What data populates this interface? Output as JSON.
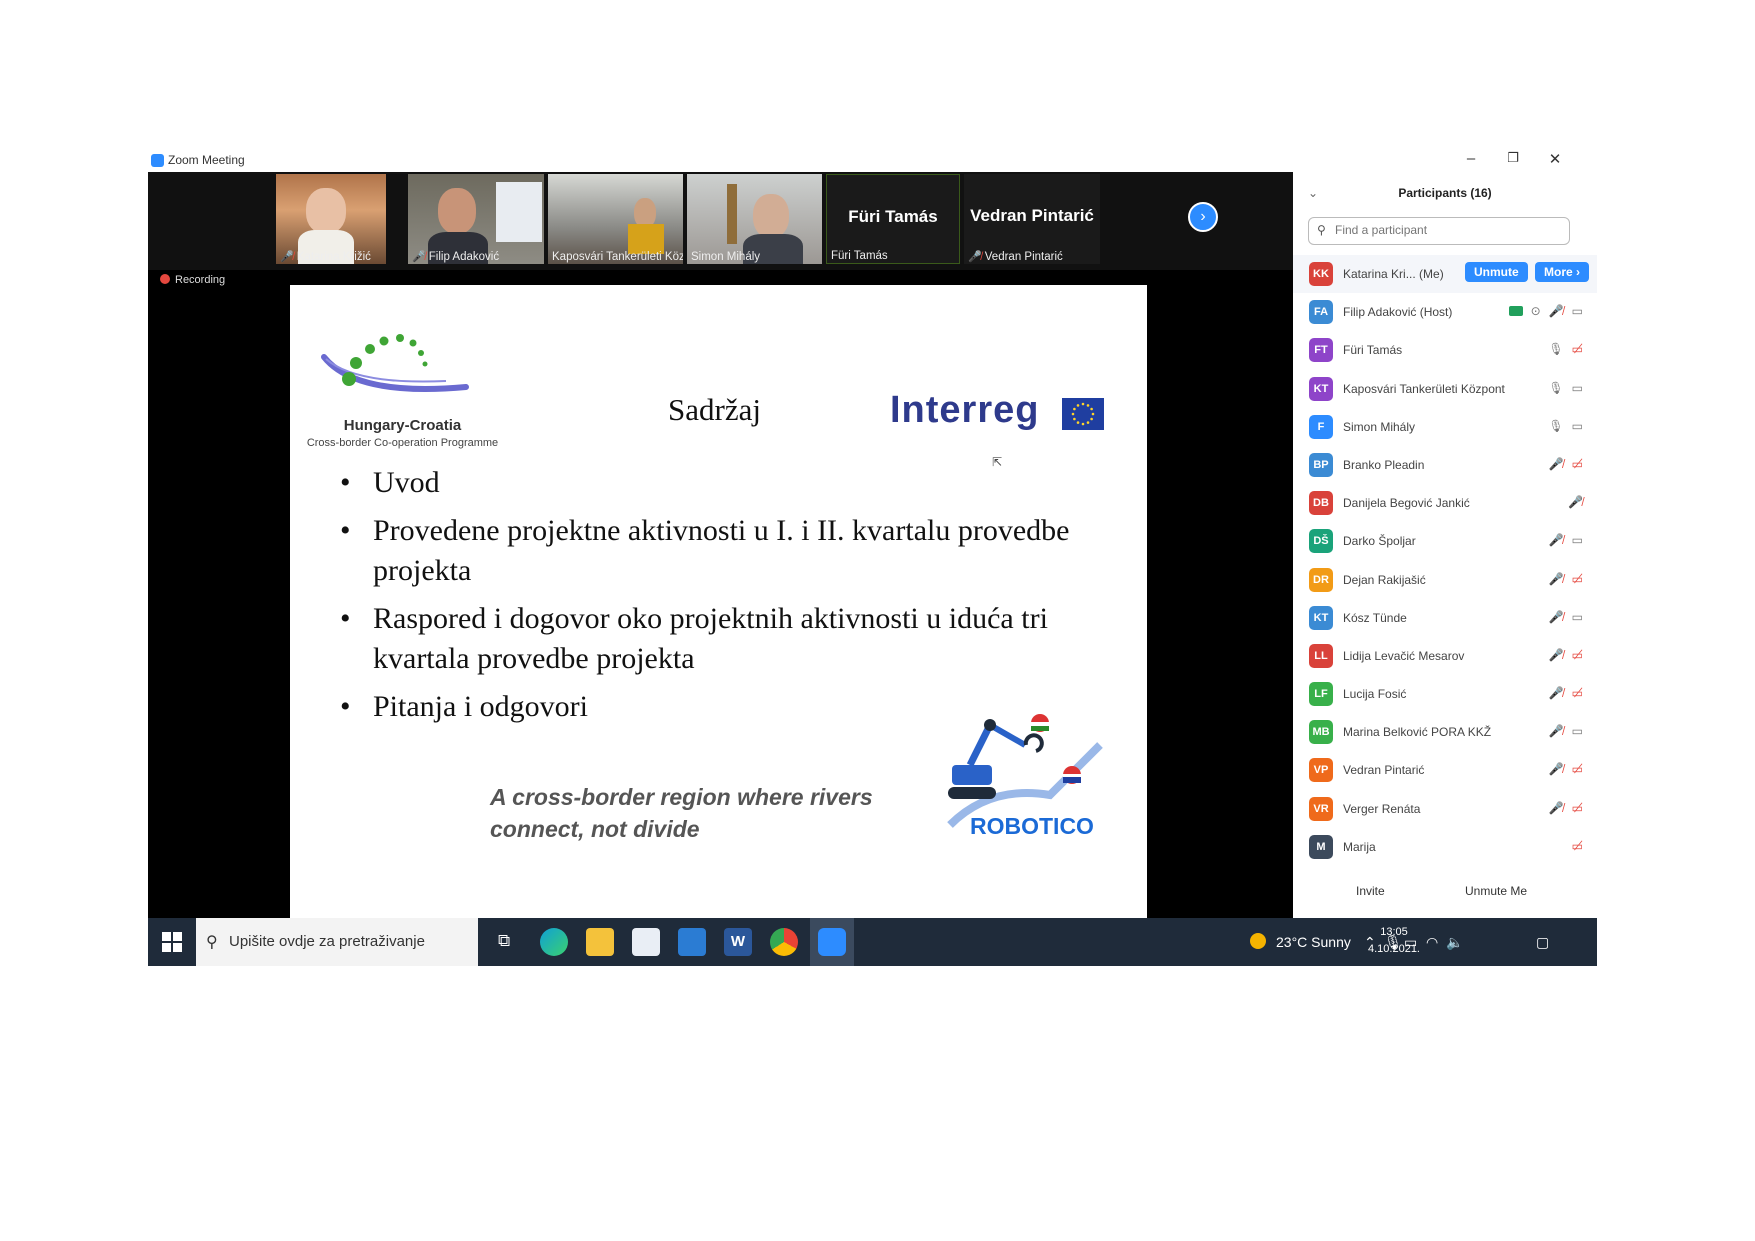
{
  "window": {
    "title": "Zoom Meeting",
    "controls": {
      "minimize": "–",
      "restore": "❐",
      "close": "✕"
    }
  },
  "video_strip": {
    "thumbnails": [
      {
        "name": "Katarina Križić",
        "muted": true
      },
      {
        "name": "Filip Adaković",
        "muted": true
      },
      {
        "name": "Kaposvári Tankerületi Köz...",
        "muted": false
      },
      {
        "name": "Simon Mihály",
        "muted": false
      }
    ],
    "name_tiles": [
      {
        "big": "Füri Tamás",
        "label": "Füri Tamás"
      },
      {
        "big": "Vedran Pintarić",
        "label": "Vedran Pintarić"
      }
    ],
    "next_arrow": "›"
  },
  "recording": "Recording",
  "slide": {
    "logo_title": "Hungary-Croatia",
    "logo_subtitle": "Cross-border Co-operation Programme",
    "title": "Sadržaj",
    "interreg": "Interreg",
    "bullets": [
      "Uvod",
      "Provedene projektne aktivnosti u I. i II. kvartalu provedbe projekta",
      "Raspored i dogovor oko projektnih aktivnosti u iduća tri kvartala provedbe projekta",
      "Pitanja i odgovori"
    ],
    "tagline": "A cross-border region where rivers connect, not divide",
    "robotico": "ROBOTICO"
  },
  "participants": {
    "header": "Participants (16)",
    "search_placeholder": "Find a participant",
    "list": [
      {
        "initials": "KK",
        "color": "#d9423a",
        "name": "Katarina Kri... (Me)",
        "unmute": "Unmute",
        "more": "More ›"
      },
      {
        "initials": "FA",
        "color": "#3b8bd4",
        "name": "Filip Adaković (Host)"
      },
      {
        "initials": "FT",
        "color": "#8e44c9",
        "name": "Füri Tamás"
      },
      {
        "initials": "KT",
        "color": "#8e44c9",
        "name": "Kaposvári Tankerületi Központ"
      },
      {
        "initials": "F",
        "color": "#2d8cff",
        "name": "Simon Mihály"
      },
      {
        "initials": "BP",
        "color": "#3b8bd4",
        "name": "Branko Pleadin"
      },
      {
        "initials": "DB",
        "color": "#d9423a",
        "name": "Danijela Begović Jankić"
      },
      {
        "initials": "DŠ",
        "color": "#1aa37a",
        "name": "Darko Špoljar"
      },
      {
        "initials": "DR",
        "color": "#f29b16",
        "name": "Dejan Rakijašić"
      },
      {
        "initials": "KT",
        "color": "#3b8bd4",
        "name": "Kósz Tünde"
      },
      {
        "initials": "LL",
        "color": "#d9423a",
        "name": "Lidija Levačić Mesarov"
      },
      {
        "initials": "LF",
        "color": "#38b04a",
        "name": "Lucija Fosić"
      },
      {
        "initials": "MB",
        "color": "#38b04a",
        "name": "Marina Belković PORA KKŽ"
      },
      {
        "initials": "VP",
        "color": "#ef6a1b",
        "name": "Vedran Pintarić"
      },
      {
        "initials": "VR",
        "color": "#ef6a1b",
        "name": "Verger Renáta"
      },
      {
        "initials": "M",
        "color": "#3c4a5c",
        "name": "Marija"
      }
    ],
    "invite": "Invite",
    "unmute_me": "Unmute Me"
  },
  "taskbar": {
    "search_text": "Upišite ovdje za pretraživanje",
    "weather": "23°C  Sunny",
    "time": "13:05",
    "date": "4.10.2021."
  }
}
